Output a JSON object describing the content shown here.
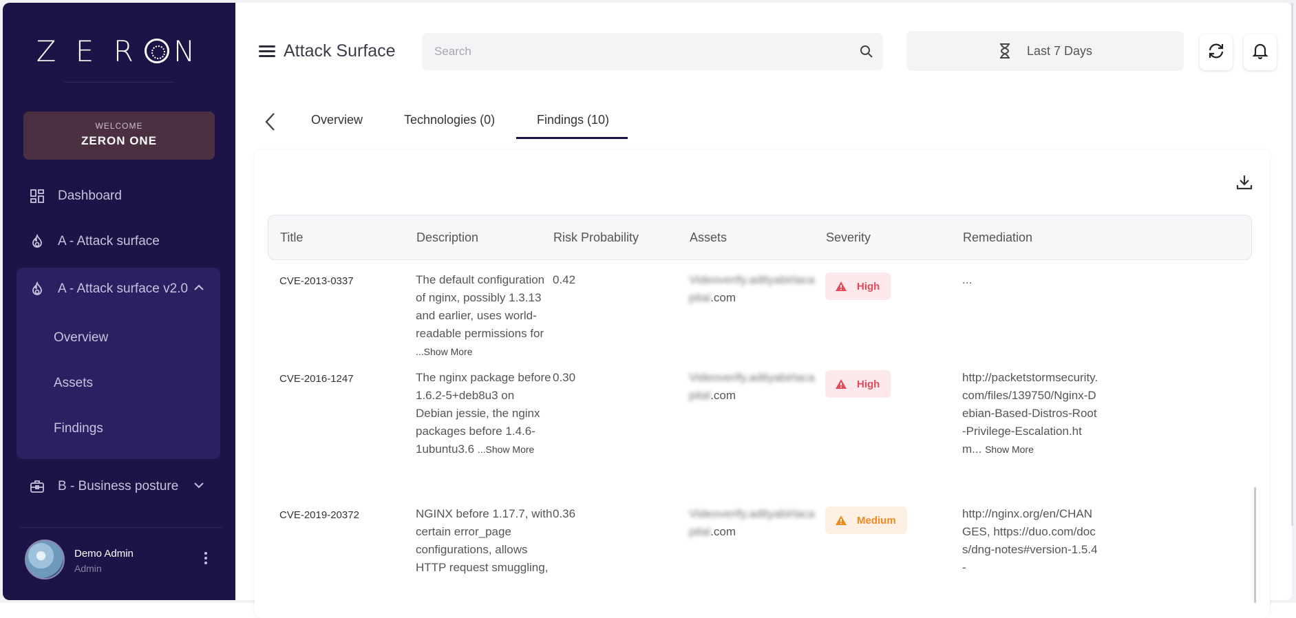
{
  "sidebar": {
    "logo": "ZERON",
    "welcome_label": "WELCOME",
    "welcome_name": "ZERON ONE",
    "items": [
      {
        "label": "Dashboard",
        "icon": "dashboard-icon"
      },
      {
        "label": "A - Attack surface",
        "icon": "flame-icon"
      },
      {
        "label": "A - Attack surface v2.0",
        "icon": "flame-icon",
        "expanded": true
      },
      {
        "label": "B - Business posture",
        "icon": "briefcase-icon",
        "expanded": false
      }
    ],
    "subitems": [
      {
        "label": "Overview"
      },
      {
        "label": "Assets"
      },
      {
        "label": "Findings"
      }
    ],
    "user": {
      "name": "Demo Admin",
      "role": "Admin"
    }
  },
  "header": {
    "title": "Attack Surface",
    "search_placeholder": "Search",
    "range_label": "Last 7 Days"
  },
  "tabs": [
    {
      "label": "Overview"
    },
    {
      "label": "Technologies (0)"
    },
    {
      "label": "Findings (10)",
      "active": true
    }
  ],
  "table": {
    "columns": [
      "Title",
      "Description",
      "Risk Probability",
      "Assets",
      "Severity",
      "Remediation"
    ],
    "rows": [
      {
        "title": "CVE-2013-0337",
        "description": "The default configuration of nginx, possibly 1.3.13 and earlier, uses world-readable permissions for",
        "description_more": "...Show More",
        "risk": "0.42",
        "asset_blurred": "Videoverify.adityabirlaca",
        "asset_blurred_2": "pital",
        "asset_suffix": ".com",
        "severity": "High",
        "remediation": "...",
        "remediation_more": ""
      },
      {
        "title": "CVE-2016-1247",
        "description": "The nginx package before 1.6.2-5+deb8u3 on Debian jessie, the nginx packages before 1.4.6-1ubuntu3.6",
        "description_more": "...Show More",
        "risk": "0.30",
        "asset_blurred": "Videoverify.adityabirlaca",
        "asset_blurred_2": "pital",
        "asset_suffix": ".com",
        "severity": "High",
        "remediation": "http://packetstormsecurity.com/files/139750/Nginx-Debian-Based-Distros-Root-Privilege-Escalation.htm...",
        "remediation_more": "Show More"
      },
      {
        "title": "CVE-2019-20372",
        "description": "NGINX before 1.17.7, with certain error_page configurations, allows HTTP request smuggling,",
        "description_more": "",
        "risk": "0.36",
        "asset_blurred": "Videoverify.adityabirlaca",
        "asset_blurred_2": "pital",
        "asset_suffix": ".com",
        "severity": "Medium",
        "remediation": "http://nginx.org/en/CHANGES, https://duo.com/docs/dng-notes#version-1.5.4-",
        "remediation_more": ""
      }
    ]
  },
  "colors": {
    "sidebar_bg": "#1c1446",
    "sidebar_group_bg": "#2a2062",
    "welcome_bg": "#4a3040",
    "high": "#e34b5a",
    "medium": "#ef8a21"
  }
}
